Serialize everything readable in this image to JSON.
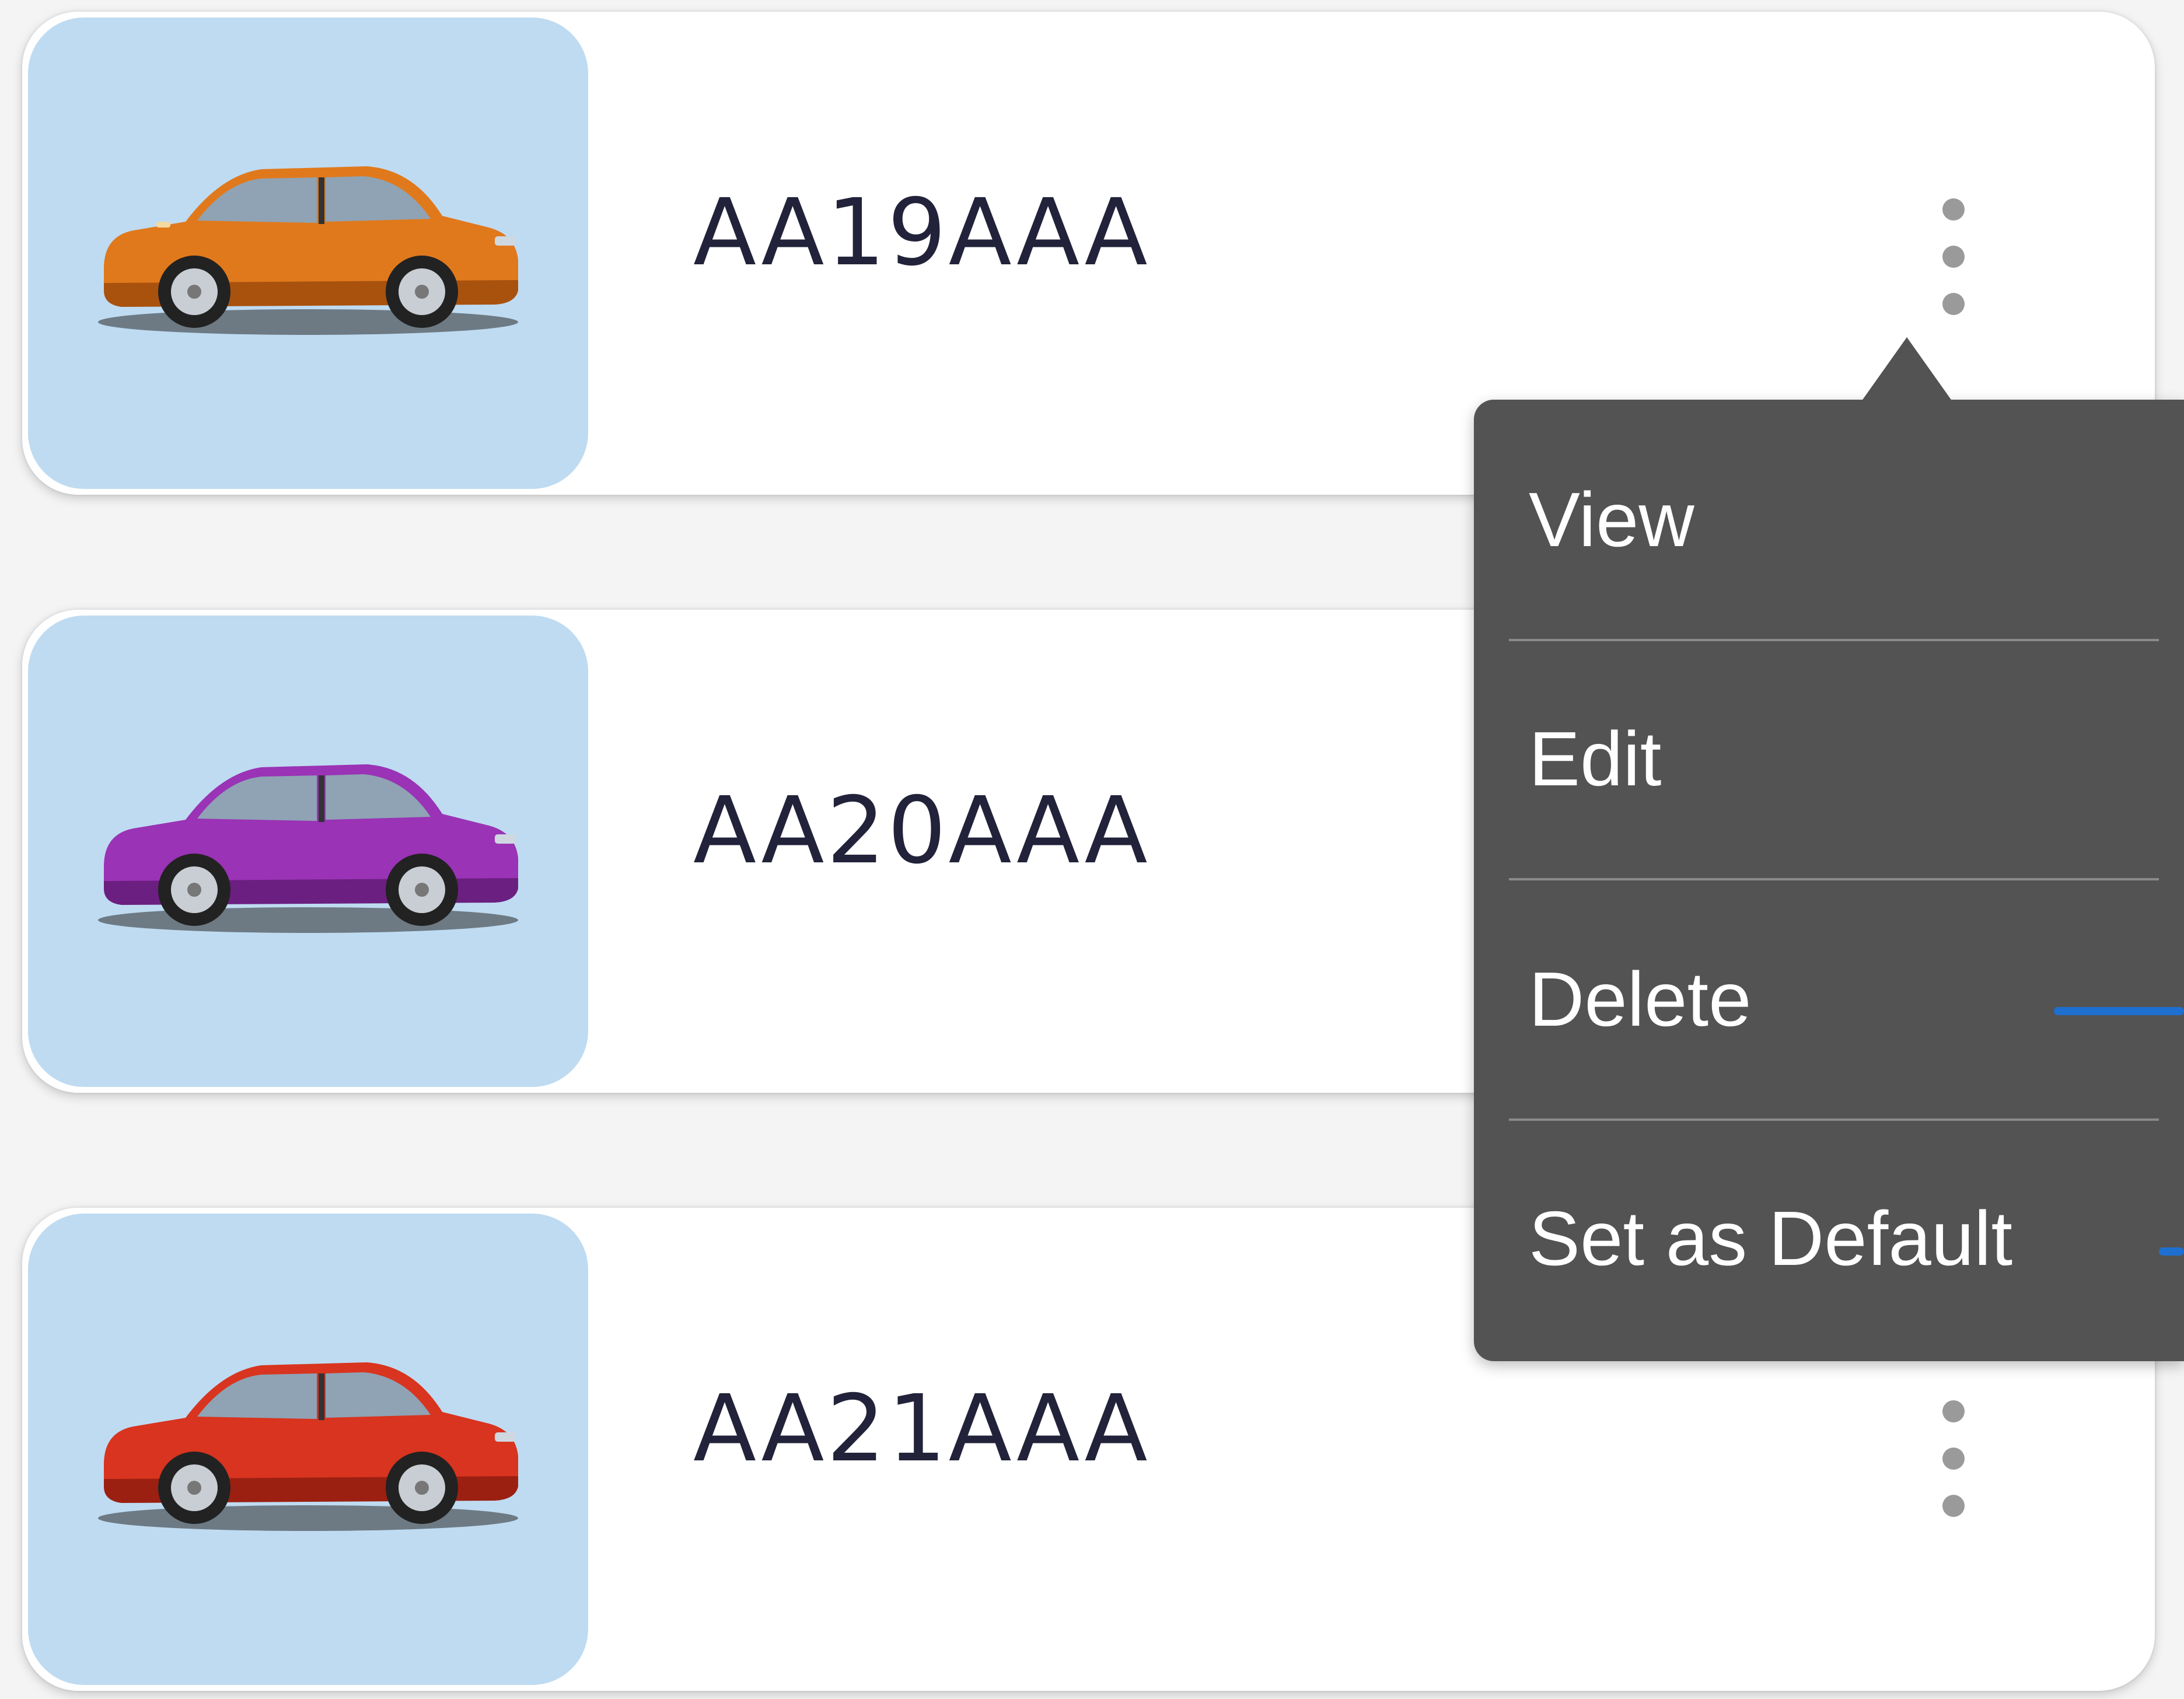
{
  "vehicles": [
    {
      "registration": "AA19AAA",
      "car_color": "#e0791c",
      "car_color_dark": "#a9520e",
      "car_icon": "car-suv-orange"
    },
    {
      "registration": "AA20AAA",
      "car_color": "#9a33b5",
      "car_color_dark": "#6b1f80",
      "car_icon": "car-suv-purple"
    },
    {
      "registration": "AA21AAA",
      "car_color": "#d8341f",
      "car_color_dark": "#9b2012",
      "car_icon": "car-suv-red"
    }
  ],
  "context_menu": {
    "items": [
      {
        "label": "View"
      },
      {
        "label": "Edit"
      },
      {
        "label": "Delete"
      },
      {
        "label": "Set as Default"
      }
    ]
  },
  "colors": {
    "thumbnail_bg": "#bfdbf1",
    "menu_bg": "#535353",
    "plate_text": "#22223a",
    "kebab_dot": "#9a9a9a",
    "accent_blue": "#1f6fd1"
  },
  "icons": {
    "more_options": "kebab-menu-icon"
  }
}
